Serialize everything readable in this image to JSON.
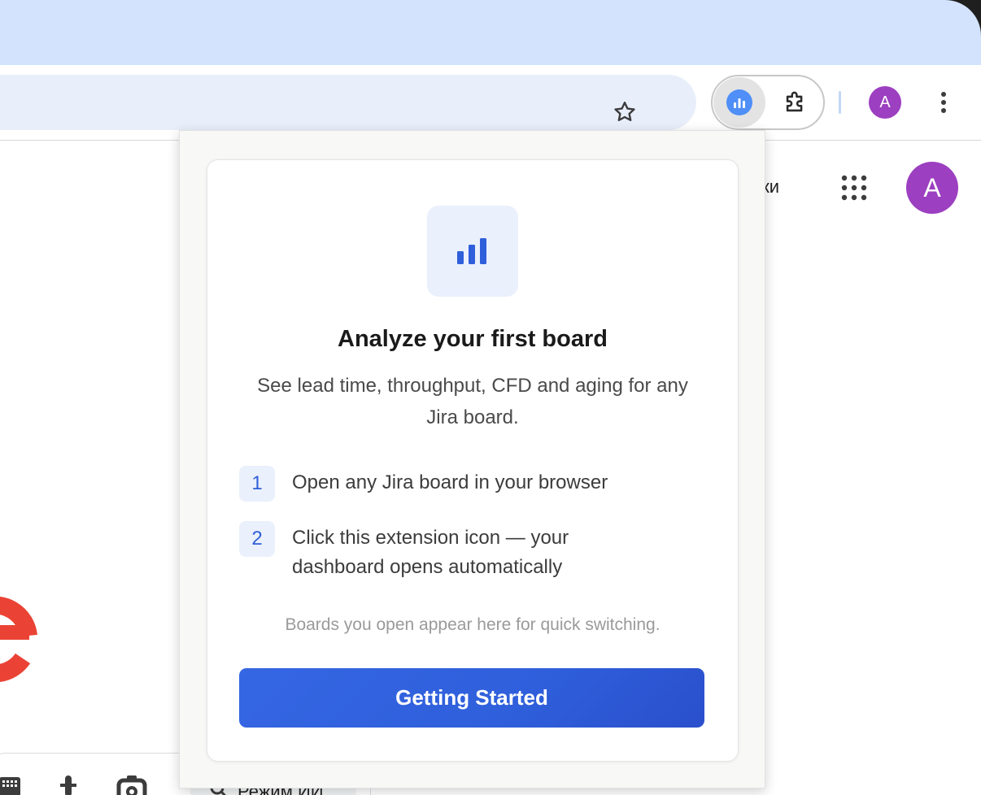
{
  "browser": {
    "profile_initial": "A",
    "icons": {
      "bookmark": "star-outline-icon",
      "extension_active": "bar-chart-icon",
      "extensions": "puzzle-icon",
      "menu": "more-vert-icon"
    }
  },
  "page": {
    "top_link": "нки",
    "profile_initial": "A",
    "bottom_pill_label": "Режим ИИ",
    "icons": [
      "keyboard-icon",
      "microphone-icon",
      "camera-icon",
      "apps-grid-icon"
    ]
  },
  "popup": {
    "title": "Analyze your first board",
    "subtitle": "See lead time, throughput, CFD and aging for any Jira board.",
    "steps": [
      {
        "number": "1",
        "text": "Open any Jira board in your browser"
      },
      {
        "number": "2",
        "text": "Click this extension icon — your dashboard opens automatically"
      }
    ],
    "hint": "Boards you open appear here for quick switching.",
    "cta_label": "Getting Started",
    "colors": {
      "accent": "#2f5fdb",
      "icon_bg": "#eaf0fc",
      "text_primary": "#1a1a1a",
      "text_secondary": "#4a4a4a",
      "hint": "#9a9a9a"
    }
  }
}
